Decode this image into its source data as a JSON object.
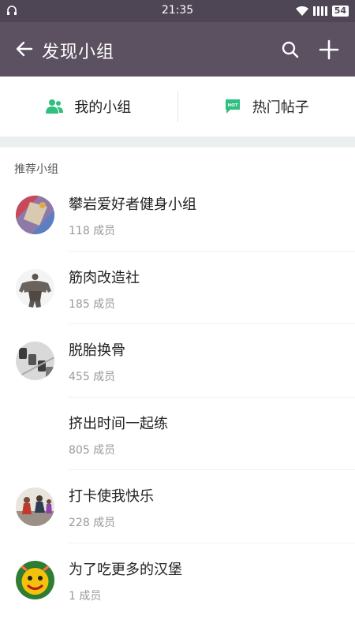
{
  "status_bar": {
    "time": "21:35",
    "battery": "54"
  },
  "app_bar": {
    "title": "发现小组"
  },
  "tabs": [
    {
      "label": "我的小组",
      "icon": "group-icon"
    },
    {
      "label": "热门帖子",
      "icon": "hot-chat-icon",
      "badge": "HOT"
    }
  ],
  "section_title": "推荐小组",
  "groups": [
    {
      "name": "攀岩爱好者健身小组",
      "members": "118 成员",
      "avatar": "climbing-avatar"
    },
    {
      "name": "筋肉改造社",
      "members": "185 成员",
      "avatar": "bodybuilder-avatar"
    },
    {
      "name": "脱胎换骨",
      "members": "455 成员",
      "avatar": "dumbbells-avatar"
    },
    {
      "name": "挤出时间一起练",
      "members": "805 成员",
      "avatar": "blank-avatar"
    },
    {
      "name": "打卡使我快乐",
      "members": "228 成员",
      "avatar": "gym-class-avatar"
    },
    {
      "name": "为了吃更多的汉堡",
      "members": "1 成员",
      "avatar": "cartoon-avatar"
    }
  ],
  "colors": {
    "status_bar": "#4f4655",
    "app_bar": "#5b5160",
    "accent_green": "#2fbf7f"
  }
}
